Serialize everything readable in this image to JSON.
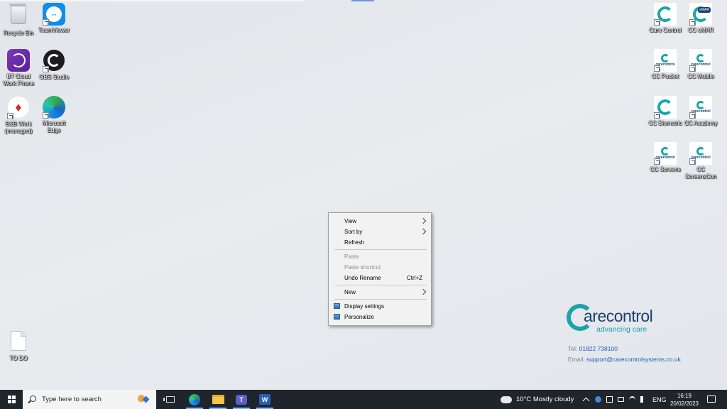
{
  "desktop": {
    "left_icons": [
      {
        "label": "Recycle Bin"
      },
      {
        "label": "TeamViewer"
      },
      {
        "label": "BT Cloud Work Phone"
      },
      {
        "label": "OBS Studio"
      },
      {
        "label": "B&B Work (managed)"
      },
      {
        "label": "Microsoft Edge"
      },
      {
        "label": "TO DO"
      }
    ],
    "right_icons": [
      {
        "label": "Care Control"
      },
      {
        "label": "CC eMAR",
        "badge": "eMAR"
      },
      {
        "label": "CC Pocket"
      },
      {
        "label": "CC Mobile"
      },
      {
        "label": "CC Biometric"
      },
      {
        "label": "CC Academy"
      },
      {
        "label": "CC Screens"
      },
      {
        "label": "CC ScreensCon"
      }
    ],
    "icon_text": {
      "cc_small": "carecontrol"
    }
  },
  "context_menu": {
    "items": [
      {
        "label": "View"
      },
      {
        "label": "Sort by"
      },
      {
        "label": "Refresh"
      },
      {
        "label": "Paste"
      },
      {
        "label": "Paste shortcut"
      },
      {
        "label": "Undo Rename",
        "shortcut": "Ctrl+Z"
      },
      {
        "label": "New"
      },
      {
        "label": "Display settings"
      },
      {
        "label": "Personalize"
      }
    ]
  },
  "logo": {
    "word": "arecontrol",
    "tagline": "advancing care",
    "tel_label": "Tel:",
    "tel_value": "01822 738100",
    "email_label": "Email:",
    "email_value": "support@carecontrolsystems.co.uk"
  },
  "taskbar": {
    "search_placeholder": "Type here to search",
    "teams_letter": "T",
    "word_letter": "W",
    "weather": "10°C  Mostly cloudy",
    "language": "ENG",
    "time": "16:19",
    "date": "20/02/2023"
  },
  "colors": {
    "accent": "#1aa3aa",
    "brand_navy": "#1a3f6e",
    "taskbar": "#20252c",
    "link": "#1e5fb4"
  }
}
